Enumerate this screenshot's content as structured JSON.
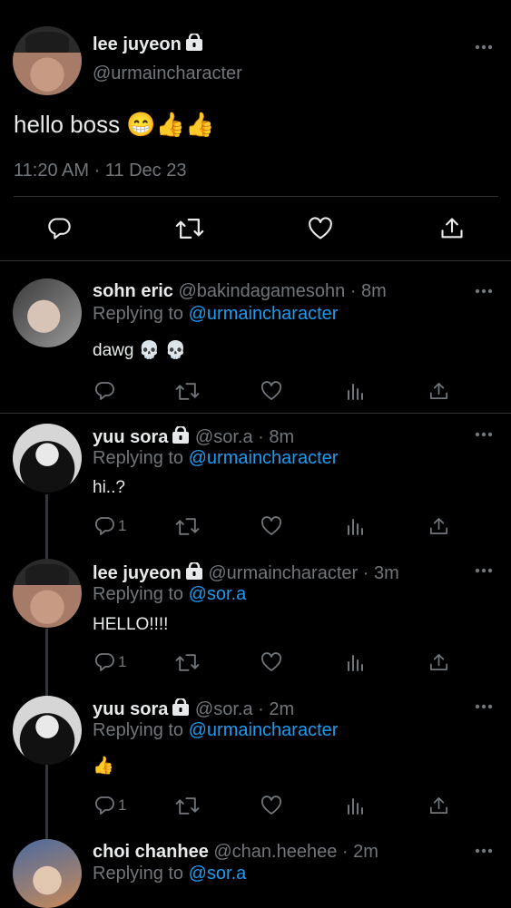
{
  "colors": {
    "background": "#000000",
    "text": "#e7e9ea",
    "muted": "#71767b",
    "accent": "#1d9bf0",
    "divider": "#2f3336"
  },
  "main_tweet": {
    "name": "lee juyeon",
    "handle": "@urmaincharacter",
    "text": "hello boss 😁👍👍",
    "timestamp": "11:20 AM · 11 Dec 23",
    "locked": true,
    "actions": [
      "reply-icon",
      "retweet-icon",
      "like-icon",
      "share-icon"
    ]
  },
  "replies": [
    {
      "name": "sohn eric",
      "handle": "@bakindagamesohn",
      "time": "· 8m",
      "replying_label": "Replying to",
      "replying_to": "@urmaincharacter",
      "text": "dawg 💀 💀",
      "reply_count": "",
      "locked": false
    },
    {
      "name": "yuu sora",
      "handle": "@sor.a",
      "time": "· 8m",
      "replying_label": "Replying to",
      "replying_to": "@urmaincharacter",
      "text": "hi..?",
      "reply_count": "1",
      "locked": true
    },
    {
      "name": "lee juyeon",
      "handle": "@urmaincharacter",
      "time": "· 3m",
      "replying_label": "Replying to",
      "replying_to": "@sor.a",
      "text": "HELLO!!!!",
      "reply_count": "1",
      "locked": true
    },
    {
      "name": "yuu sora",
      "handle": "@sor.a",
      "time": "· 2m",
      "replying_label": "Replying to",
      "replying_to": "@urmaincharacter",
      "text": "👍",
      "reply_count": "1",
      "locked": true
    },
    {
      "name": "choi chanhee",
      "handle": "@chan.heehee",
      "time": "· 2m",
      "replying_label": "Replying to",
      "replying_to": "@sor.a",
      "text": "",
      "reply_count": "",
      "locked": false
    }
  ]
}
